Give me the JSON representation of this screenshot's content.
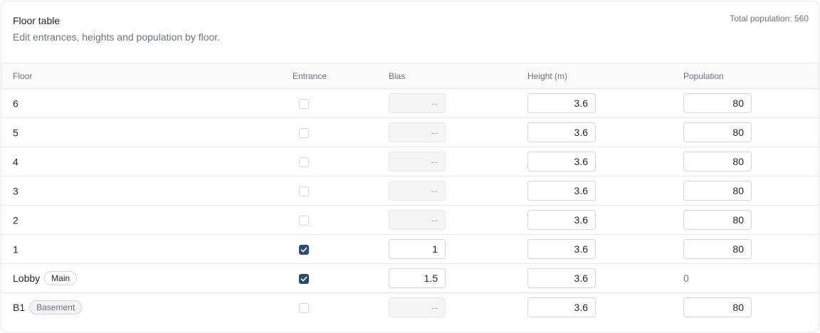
{
  "header": {
    "title": "Floor table",
    "subtitle": "Edit entrances, heights and population by floor.",
    "total": "Total population: 560"
  },
  "columns": {
    "floor": "Floor",
    "entrance": "Entrance",
    "bias": "Bias",
    "height": "Height (m)",
    "population": "Population"
  },
  "rows": [
    {
      "floor": "6",
      "tag": "",
      "entrance": false,
      "bias": "--",
      "height": "3.6",
      "population": "80"
    },
    {
      "floor": "5",
      "tag": "",
      "entrance": false,
      "bias": "--",
      "height": "3.6",
      "population": "80"
    },
    {
      "floor": "4",
      "tag": "",
      "entrance": false,
      "bias": "--",
      "height": "3.6",
      "population": "80"
    },
    {
      "floor": "3",
      "tag": "",
      "entrance": false,
      "bias": "--",
      "height": "3.6",
      "population": "80"
    },
    {
      "floor": "2",
      "tag": "",
      "entrance": false,
      "bias": "--",
      "height": "3.6",
      "population": "80"
    },
    {
      "floor": "1",
      "tag": "",
      "entrance": true,
      "bias": "1",
      "height": "3.6",
      "population": "80"
    },
    {
      "floor": "Lobby",
      "tag": "Main",
      "entrance": true,
      "bias": "1.5",
      "height": "3.6",
      "population": "0"
    },
    {
      "floor": "B1",
      "tag": "Basement",
      "entrance": false,
      "bias": "--",
      "height": "3.6",
      "population": "80"
    }
  ],
  "colors": {
    "accent": "#2f4a6d",
    "border": "#e5e7eb",
    "muted_text": "#6b7280"
  },
  "icons": {
    "checkbox_checked": "check-icon"
  }
}
